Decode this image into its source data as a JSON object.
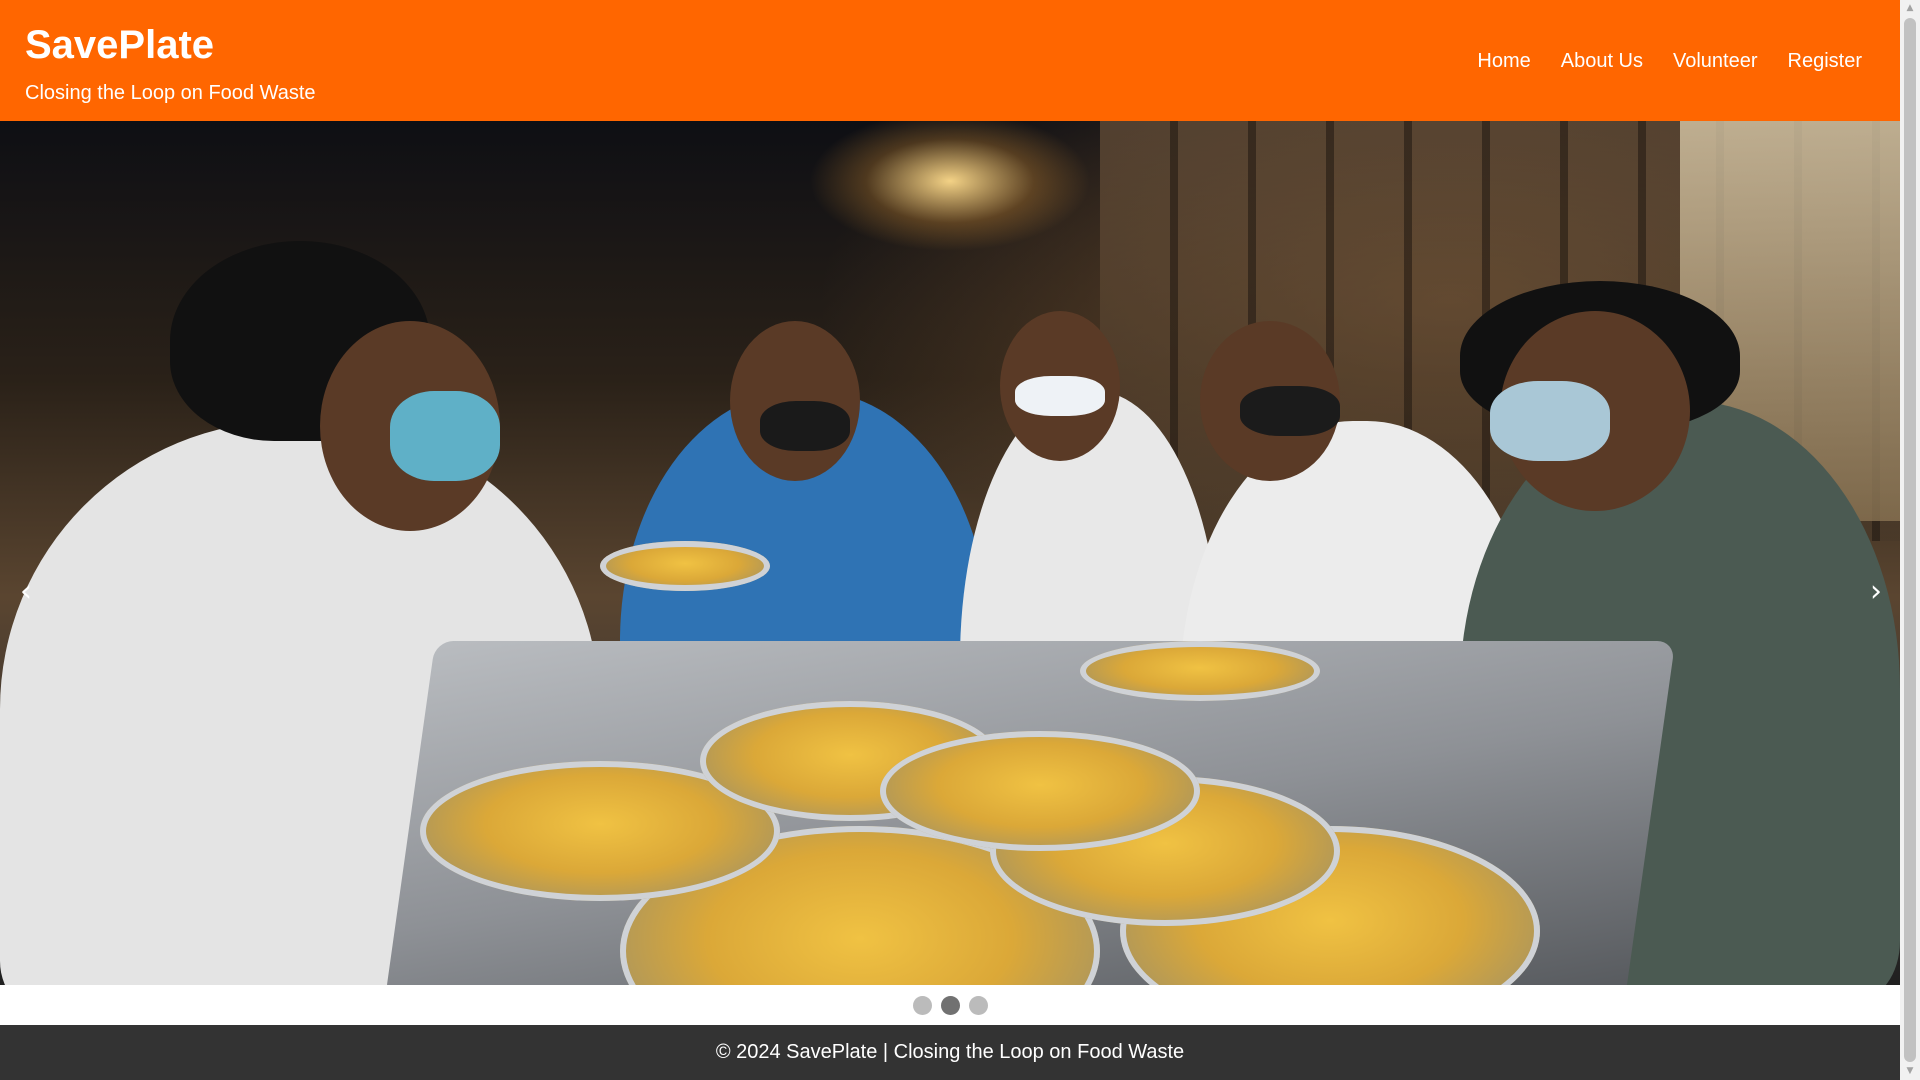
{
  "header": {
    "title": "SavePlate",
    "tagline": "Closing the Loop on Food Waste",
    "nav": [
      {
        "label": "Home"
      },
      {
        "label": "About Us"
      },
      {
        "label": "Volunteer"
      },
      {
        "label": "Register"
      }
    ]
  },
  "carousel": {
    "prev_label": "‹",
    "next_label": "›",
    "slide_count": 3,
    "active_index": 1
  },
  "footer": {
    "text": "© 2024 SavePlate | Closing the Loop on Food Waste"
  },
  "colors": {
    "header_bg": "#ff6600",
    "footer_bg": "#333333",
    "dot_inactive": "#bbbbbb",
    "dot_active": "#717171"
  },
  "icons": {
    "prev": "chevron-left-icon",
    "next": "chevron-right-icon"
  }
}
